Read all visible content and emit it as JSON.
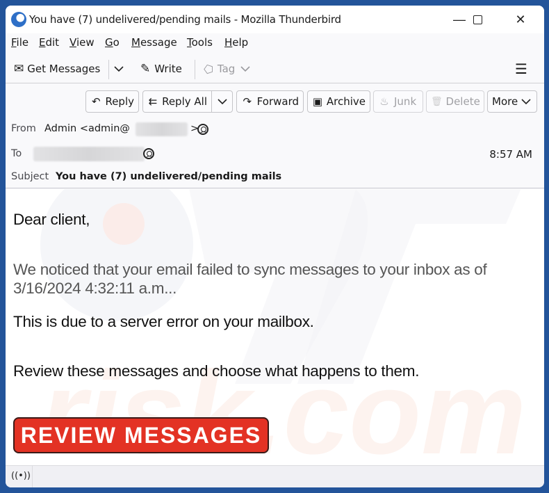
{
  "window": {
    "title": "You have (7) undelivered/pending mails - Mozilla Thunderbird",
    "controls": {
      "minimize": "—",
      "maximize": "☐",
      "close": "✕"
    }
  },
  "menubar": {
    "items": [
      {
        "label": "File",
        "mnemonic": "F"
      },
      {
        "label": "Edit",
        "mnemonic": "E"
      },
      {
        "label": "View",
        "mnemonic": "V"
      },
      {
        "label": "Go",
        "mnemonic": "G"
      },
      {
        "label": "Message",
        "mnemonic": "M"
      },
      {
        "label": "Tools",
        "mnemonic": "T"
      },
      {
        "label": "Help",
        "mnemonic": "H"
      }
    ]
  },
  "toolbar": {
    "get_messages": "Get Messages",
    "write": "Write",
    "tag": "Tag",
    "icons": {
      "get_messages": "✉",
      "dropdown": "⌄",
      "write": "✎",
      "tag": "⬠",
      "menu": "☰"
    }
  },
  "actions": {
    "reply": "Reply",
    "reply_all": "Reply All",
    "forward": "Forward",
    "archive": "Archive",
    "junk": "Junk",
    "delete": "Delete",
    "more": "More",
    "icons": {
      "reply": "↶",
      "reply_all": "⇇",
      "forward": "↷",
      "archive": "▣",
      "junk": "♨",
      "delete": "🗑",
      "chevron": "⌄"
    }
  },
  "header": {
    "from_label": "From",
    "from_name": "Admin <admin@",
    "from_close": ">",
    "to_label": "To",
    "time": "8:57 AM",
    "subject_label": "Subject",
    "subject": "You have (7) undelivered/pending mails"
  },
  "message": {
    "greeting": "Dear client,",
    "para1": "We noticed that your email failed to sync messages to your inbox as of 3/16/2024 4:32:11 a.m...",
    "para2": "This is due to a server error on your mailbox.",
    "para3": "Review these messages and choose what happens to them.",
    "cta": "REVIEW MESSAGES",
    "cta_color": "#e33224"
  },
  "statusbar": {
    "icon": "((•))"
  }
}
